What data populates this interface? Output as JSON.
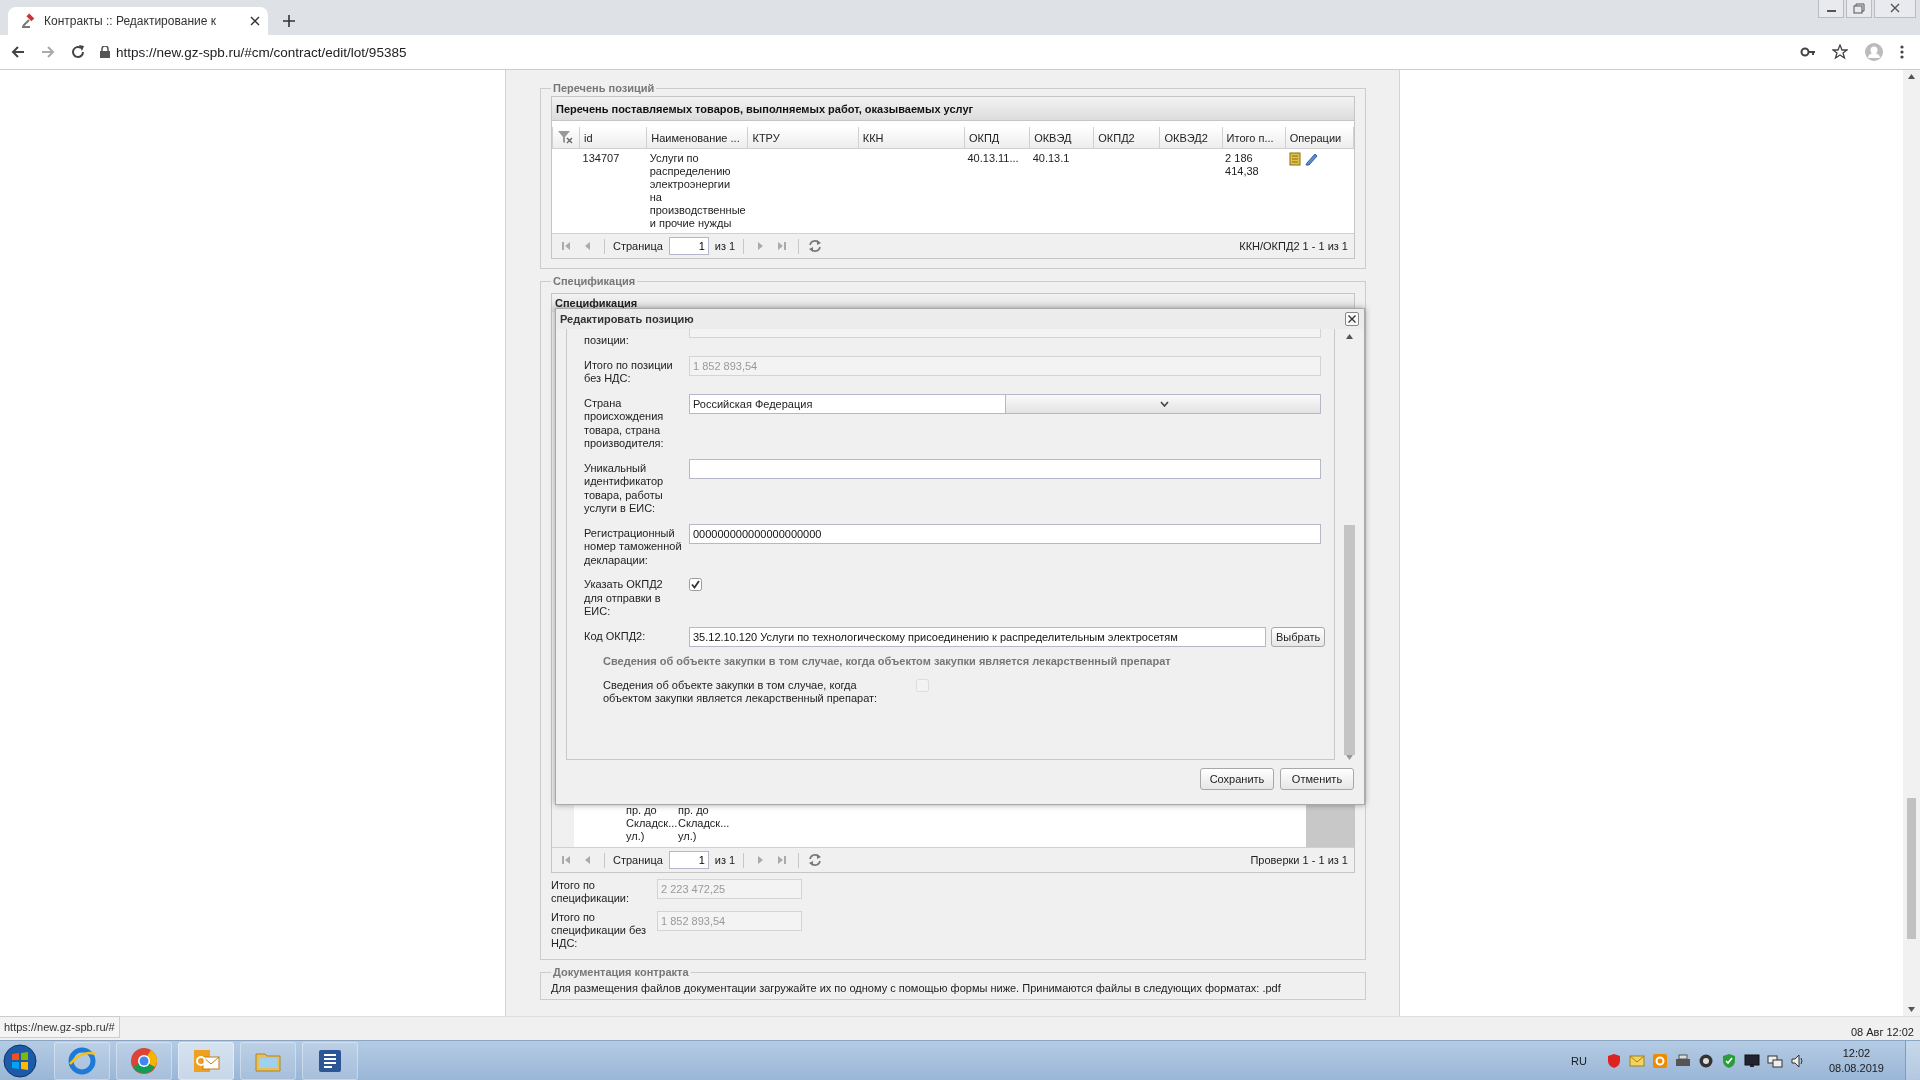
{
  "browser": {
    "tab_title": "Контракты :: Редактирование к",
    "url": "https://new.gz-spb.ru/#cm/contract/edit/lot/95385"
  },
  "positions": {
    "legend": "Перечень позиций",
    "title": "Перечень поставляемых товаров, выполняемых работ, оказываемых услуг",
    "columns": [
      "id",
      "Наименование ...",
      "КТРУ",
      "ККН",
      "ОКПД",
      "ОКВЭД",
      "ОКПД2",
      "ОКВЭД2",
      "Итого п...",
      "Операции"
    ],
    "rows": [
      {
        "id": "134707",
        "name": "Услуги по распределению электроэнергии на производственные и прочие нужды",
        "okpd": "40.13.11...",
        "okved": "40.13.1",
        "total": "2 186 414,38"
      }
    ],
    "pager": {
      "label": "Страница",
      "page": "1",
      "of": "из 1",
      "summary": "ККН/ОКПД2 1 - 1 из 1"
    }
  },
  "specification": {
    "legend": "Спецификация",
    "title": "Спецификация",
    "rows": [
      {
        "cells": [
          "пр. до Складск... ул.)",
          "пр. до Складск... ул.)"
        ]
      }
    ],
    "pager": {
      "label": "Страница",
      "page": "1",
      "of": "из 1",
      "summary": "Проверки 1 - 1 из 1"
    },
    "totals": [
      {
        "label": "Итого по спецификации:",
        "value": "2 223 472,25"
      },
      {
        "label": "Итого по спецификации без НДС:",
        "value": "1 852 893,54"
      }
    ]
  },
  "dialog": {
    "title": "Редактировать позицию",
    "fields": [
      {
        "kind": "text",
        "label": "позиции:",
        "disabled": true
      },
      {
        "kind": "text",
        "label": "Итого по позиции без НДС:",
        "value": "1 852 893,54",
        "disabled": true
      },
      {
        "kind": "select",
        "label": "Страна происхождения товара, страна производителя:",
        "value": "Российская Федерация",
        "disabled": false
      },
      {
        "kind": "text",
        "label": "Уникальный идентификатор товара, работы услуги в ЕИС:",
        "disabled": false
      },
      {
        "kind": "text",
        "label": "Регистрационный номер таможенной декларации:",
        "value": "000000000000000000000",
        "disabled": false
      },
      {
        "kind": "checkbox",
        "label": "Указать ОКПД2 для отправки в ЕИС:",
        "checked": true,
        "disabled": false
      },
      {
        "kind": "picker",
        "label": "Код ОКПД2:",
        "value": "35.12.10.120 Услуги по технологическому присоединению к распределительным электросетям",
        "button": "Выбрать",
        "disabled": false
      },
      {
        "kind": "heading",
        "label": "Сведения об объекте закупки в том случае, когда объектом закупки является лекарственный препарат"
      },
      {
        "kind": "checkbox",
        "label": "Сведения об объекте закупки в том случае, когда объектом закупки является лекарственный препарат:",
        "checked": false,
        "disabled": true
      }
    ],
    "buttons": [
      "Сохранить",
      "Отменить"
    ]
  },
  "documents": {
    "legend": "Документация контракта",
    "text": "Для размещения файлов документации загружайте их по одному с помощью формы ниже. Принимаются файлы в следующих форматах: .pdf"
  },
  "status_url": "https://new.gz-spb.ru/#",
  "footer_time": "08 Авг 12:02",
  "taskbar": {
    "language": "RU",
    "time": "12:02",
    "date": "08.08.2019"
  }
}
